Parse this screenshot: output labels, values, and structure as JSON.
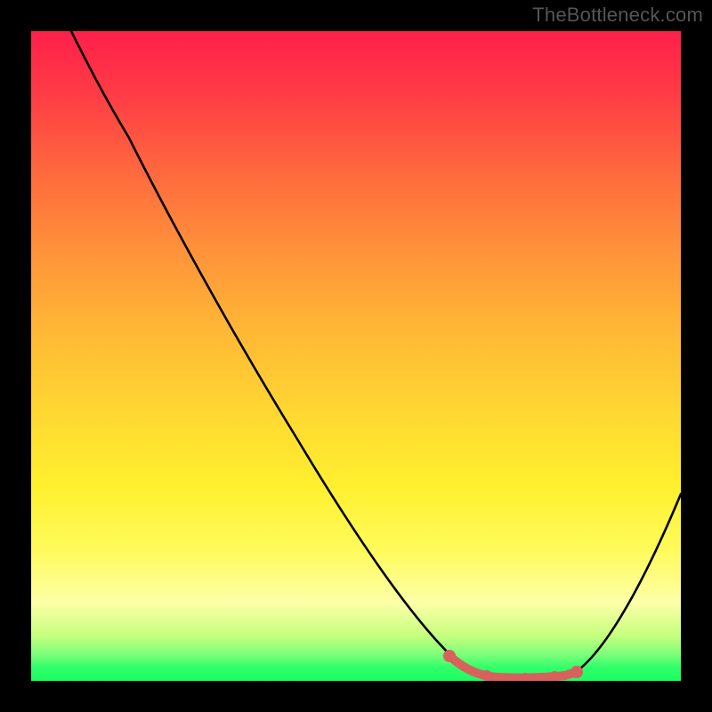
{
  "watermark": "TheBottleneck.com",
  "colors": {
    "background": "#000000",
    "curve": "#000000",
    "accent": "#d8615d"
  },
  "chart_data": {
    "type": "line",
    "title": "",
    "xlabel": "",
    "ylabel": "",
    "xlim": [
      0,
      100
    ],
    "ylim": [
      0,
      100
    ],
    "x": [
      0,
      5,
      10,
      15,
      20,
      25,
      30,
      35,
      40,
      45,
      50,
      55,
      60,
      63,
      66,
      68,
      70,
      73,
      76,
      79,
      82,
      85,
      88,
      91,
      94,
      97,
      100
    ],
    "values": [
      100,
      96,
      91,
      85,
      78,
      71,
      64,
      57,
      50,
      43,
      36,
      29,
      22,
      17,
      12,
      8,
      4,
      1.5,
      0.8,
      0.5,
      0.5,
      1.2,
      4,
      8,
      14,
      21,
      29
    ],
    "accent_range_x": [
      63,
      86
    ],
    "gradient_stops": [
      {
        "pos": 0,
        "color": "#ff1f4a",
        "meaning": "severe"
      },
      {
        "pos": 40,
        "color": "#ff9a38",
        "meaning": "high"
      },
      {
        "pos": 70,
        "color": "#fff02e",
        "meaning": "moderate"
      },
      {
        "pos": 90,
        "color": "#c6ff7e",
        "meaning": "low"
      },
      {
        "pos": 100,
        "color": "#1aff5f",
        "meaning": "optimal"
      }
    ],
    "note": "Values approximate a bottleneck curve: steep descent from top-left, minimum near x≈78, rise toward right. Y is percent bottleneck; lower (greener) is better."
  }
}
